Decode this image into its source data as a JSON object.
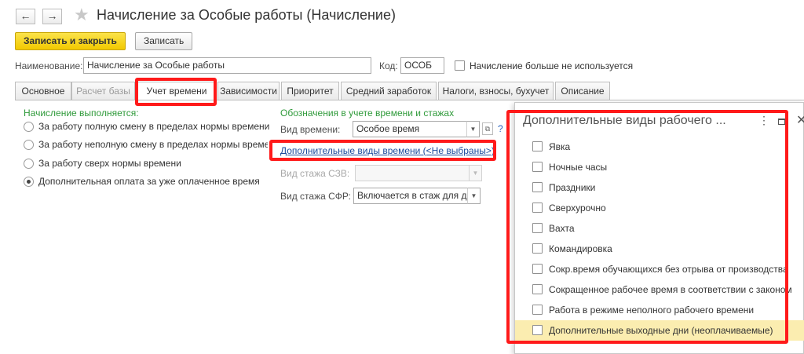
{
  "window": {
    "title": "Начисление за Особые работы (Начисление)",
    "back_icon": "←",
    "forward_icon": "→",
    "favorite_icon": "★"
  },
  "toolbar": {
    "save_close_label": "Записать и закрыть",
    "save_label": "Записать"
  },
  "header": {
    "name_label": "Наименование:",
    "name_value": "Начисление за Особые работы",
    "code_label": "Код:",
    "code_value": "ОСОБ",
    "unused_label": "Начисление больше не используется"
  },
  "tabs": [
    {
      "label": "Основное"
    },
    {
      "label": "Расчет базы"
    },
    {
      "label": "Учет времени"
    },
    {
      "label": "Зависимости"
    },
    {
      "label": "Приоритет"
    },
    {
      "label": "Средний заработок"
    },
    {
      "label": "Налоги, взносы, бухучет"
    },
    {
      "label": "Описание"
    }
  ],
  "left_section": {
    "title": "Начисление выполняется:",
    "options": [
      {
        "label": "За работу полную смену в пределах нормы времени",
        "selected": false
      },
      {
        "label": "За работу неполную смену в пределах нормы времени",
        "selected": false
      },
      {
        "label": "За работу сверх нормы времени",
        "selected": false
      },
      {
        "label": "Дополнительная оплата за уже оплаченное время",
        "selected": true
      }
    ]
  },
  "right_section": {
    "title": "Обозначения в учете времени и стажах",
    "time_type_label": "Вид времени:",
    "time_type_value": "Особое время",
    "additional_time_link": "Дополнительные виды времени (<Не выбраны>)",
    "szv_label": "Вид стажа СЗВ:",
    "szv_value": "",
    "sfr_label": "Вид стажа СФР:",
    "sfr_value": "Включается в стаж для д",
    "help_mark": "?"
  },
  "popup": {
    "title": "Дополнительные виды рабочего ...",
    "menu_icon": "⋮",
    "close_icon": "✕",
    "items": [
      {
        "label": "Явка",
        "checked": false
      },
      {
        "label": "Ночные часы",
        "checked": false
      },
      {
        "label": "Праздники",
        "checked": false
      },
      {
        "label": "Сверхурочно",
        "checked": false
      },
      {
        "label": "Вахта",
        "checked": false
      },
      {
        "label": "Командировка",
        "checked": false
      },
      {
        "label": "Сокр.время обучающихся без отрыва от производства",
        "checked": false
      },
      {
        "label": "Сокращенное рабочее время в соответствии с законом",
        "checked": false
      },
      {
        "label": "Работа в режиме неполного рабочего времени",
        "checked": false
      },
      {
        "label": "Дополнительные выходные дни (неоплачиваемые)",
        "checked": false,
        "highlighted": true
      }
    ]
  },
  "colors": {
    "accent_yellow": "#f2c900",
    "annotation_red": "#ff1a1a",
    "section_green": "#2f9a3a",
    "link_blue": "#1a4a9c",
    "highlight_row": "#fbedb0"
  }
}
